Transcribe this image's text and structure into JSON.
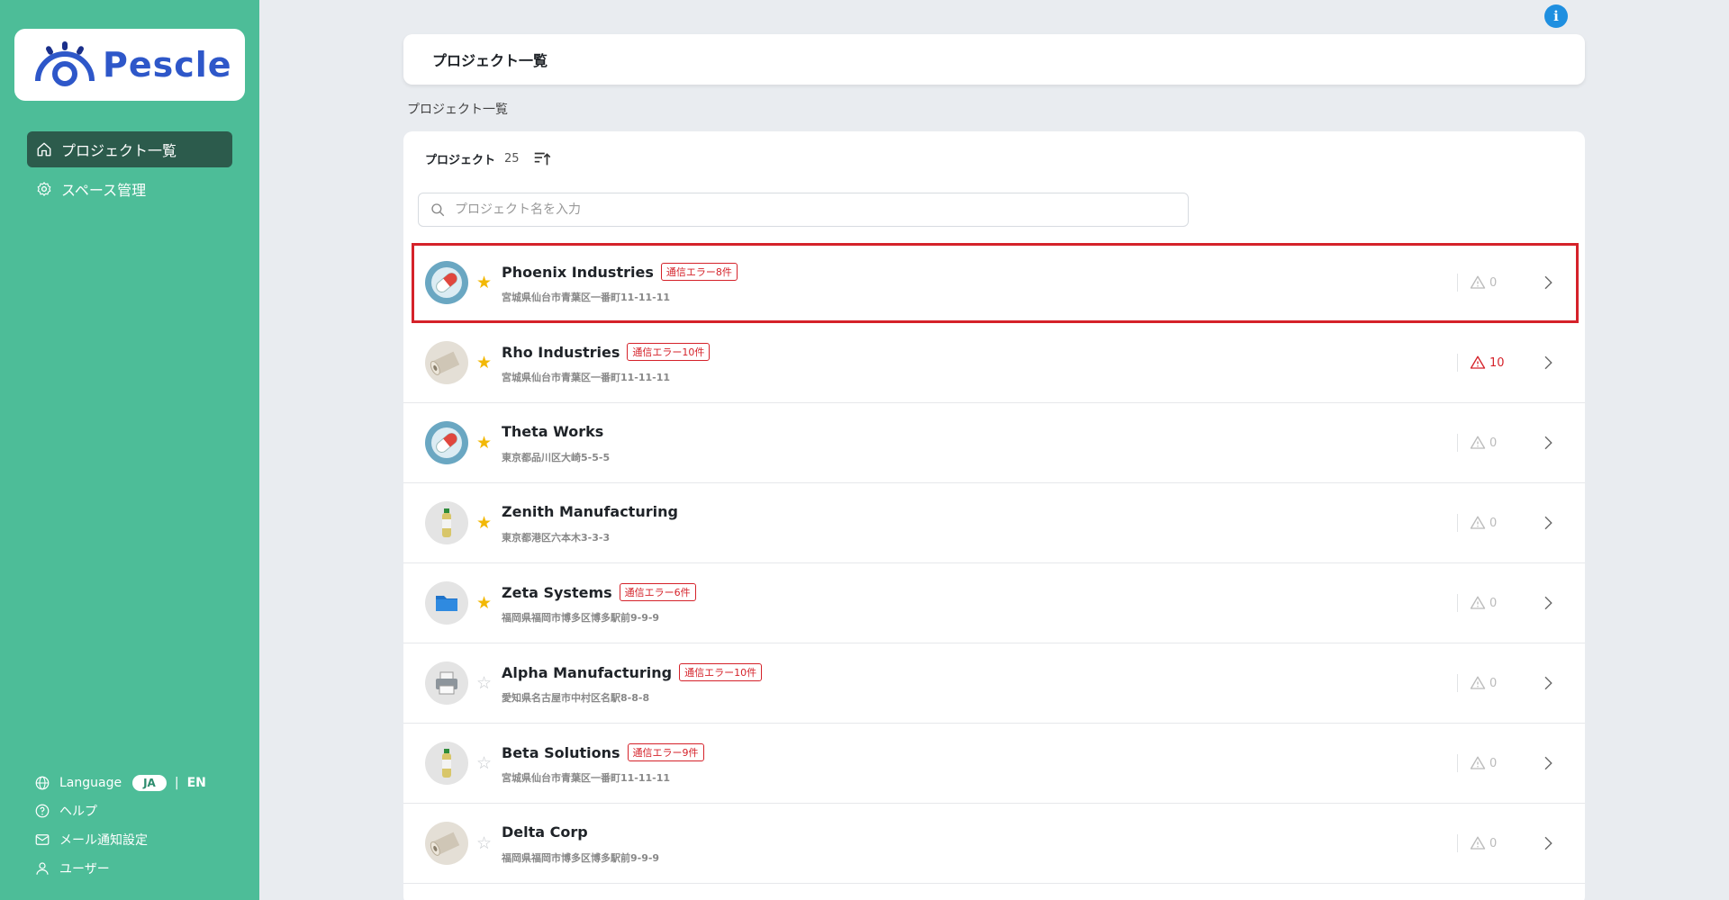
{
  "app": {
    "name": "Pescle"
  },
  "sidebar": {
    "nav": [
      {
        "label": "プロジェクト一覧",
        "icon": "home-icon",
        "active": true
      },
      {
        "label": "スペース管理",
        "icon": "gear-icon",
        "active": false
      }
    ],
    "language_label": "Language",
    "lang_active": "JA",
    "lang_sep": "|",
    "lang_other": "EN",
    "help_label": "ヘルプ",
    "mail_label": "メール通知設定",
    "user_label": "ユーザー"
  },
  "info_button": "i",
  "header": {
    "title": "プロジェクト一覧"
  },
  "breadcrumb": "プロジェクト一覧",
  "list": {
    "heading": "プロジェクト",
    "count": "25",
    "search_placeholder": "プロジェクト名を入力",
    "rows": [
      {
        "name": "Phoenix Industries",
        "badge": "通信エラー8件",
        "address": "宮城県仙台市青葉区一番町11-11-11",
        "starred": true,
        "alerts": "0",
        "alert_error": false,
        "icon": "pill-icon"
      },
      {
        "name": "Rho Industries",
        "badge": "通信エラー10件",
        "address": "宮城県仙台市青葉区一番町11-11-11",
        "starred": true,
        "alerts": "10",
        "alert_error": true,
        "icon": "roll-icon"
      },
      {
        "name": "Theta Works",
        "badge": "",
        "address": "東京都品川区大崎5-5-5",
        "starred": true,
        "alerts": "0",
        "alert_error": false,
        "icon": "pill-icon"
      },
      {
        "name": "Zenith Manufacturing",
        "badge": "",
        "address": "東京都港区六本木3-3-3",
        "starred": true,
        "alerts": "0",
        "alert_error": false,
        "icon": "bottle-icon"
      },
      {
        "name": "Zeta Systems",
        "badge": "通信エラー6件",
        "address": "福岡県福岡市博多区博多駅前9-9-9",
        "starred": true,
        "alerts": "0",
        "alert_error": false,
        "icon": "folder-icon"
      },
      {
        "name": "Alpha Manufacturing",
        "badge": "通信エラー10件",
        "address": "愛知県名古屋市中村区名駅8-8-8",
        "starred": false,
        "alerts": "0",
        "alert_error": false,
        "icon": "printer-icon"
      },
      {
        "name": "Beta Solutions",
        "badge": "通信エラー9件",
        "address": "宮城県仙台市青葉区一番町11-11-11",
        "starred": false,
        "alerts": "0",
        "alert_error": false,
        "icon": "bottle-icon"
      },
      {
        "name": "Delta Corp",
        "badge": "",
        "address": "福岡県福岡市博多区博多駅前9-9-9",
        "starred": false,
        "alerts": "0",
        "alert_error": false,
        "icon": "roll-icon"
      }
    ]
  },
  "colors": {
    "sidebar": "#4dbd98",
    "sidebar_active": "#2c5b4c",
    "error": "#d5222a",
    "star": "#f2b806",
    "brand": "#2e57c9"
  }
}
